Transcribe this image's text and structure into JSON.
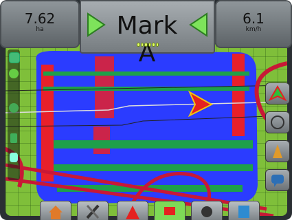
{
  "header": {
    "area": {
      "value": "7.62",
      "unit": "ha"
    },
    "title": "Mark A",
    "speed": {
      "value": "6.1",
      "unit": "km/h"
    },
    "satellite_dots": 6
  },
  "colors": {
    "field_green": "#7fbf3a",
    "coverage_blue": "#2b3cff",
    "coverage_red": "#e8202a",
    "stripe_green": "#1ea04a",
    "annotation_red": "#c81836",
    "accent_arrow": "#7ee35b"
  },
  "left_toolbar": {
    "icons": [
      "tractor-icon",
      "gps-icon",
      "steering-icon",
      "boom-icon",
      "section-icon"
    ]
  },
  "right_toolbar": {
    "icons": [
      "mark-a-arrow-icon",
      "steering-wheel-icon",
      "vehicle-view-icon",
      "message-icon"
    ]
  },
  "bottom_toolbar": {
    "icons": [
      "home-icon",
      "tools-icon",
      "warning-icon",
      "mark-icon",
      "speaker-icon",
      "tablet-icon"
    ]
  }
}
